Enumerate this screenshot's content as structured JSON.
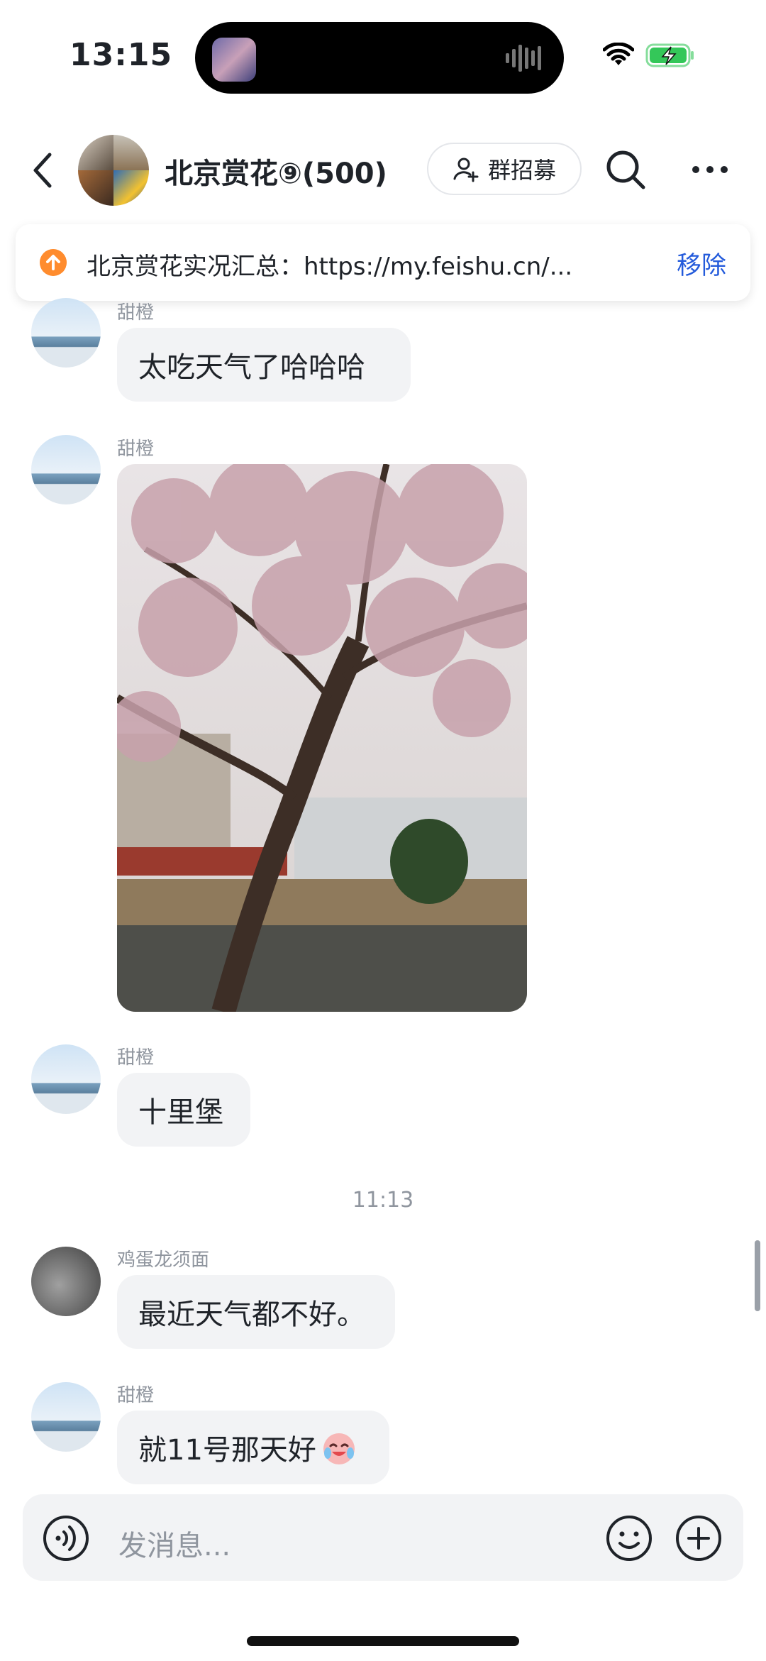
{
  "status_bar": {
    "time": "13:15"
  },
  "header": {
    "title": "北京赏花⑨(500)",
    "recruit_label": "群招募"
  },
  "pinned": {
    "text": "北京赏花实况汇总：https://my.feishu.cn/...",
    "remove_label": "移除"
  },
  "messages": [
    {
      "sender": "甜橙",
      "text": "太吃天气了哈哈哈"
    },
    {
      "sender": "甜橙",
      "type": "image"
    },
    {
      "sender": "甜橙",
      "text": "十里堡"
    },
    {
      "sender": "鸡蛋龙须面",
      "text": "最近天气都不好。"
    },
    {
      "sender": "甜橙",
      "text": "就11号那天好"
    }
  ],
  "time_divider": "11:13",
  "input": {
    "placeholder": "发消息..."
  },
  "colors": {
    "accent": "#245bdb",
    "bubble": "#f2f3f5",
    "pin_icon": "#ff8c2e",
    "battery": "#34c759"
  }
}
